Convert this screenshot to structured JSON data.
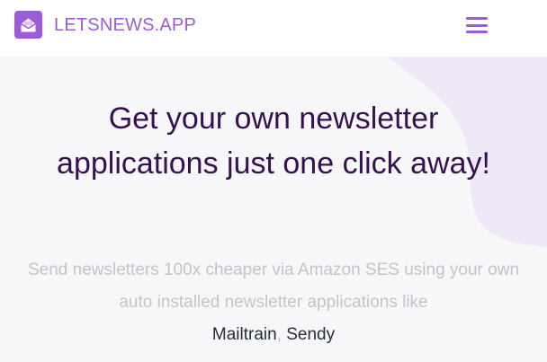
{
  "header": {
    "brand": "LETSNEWS.APP",
    "logo_icon": "envelope-open-icon",
    "menu_icon": "hamburger-menu-icon"
  },
  "hero": {
    "headline": "Get your own newsletter applications just one click away!",
    "subtext": "Send newsletters 100x cheaper via Amazon SES using your own auto installed newsletter applications like",
    "apps": [
      "Mailtrain",
      "Sendy"
    ],
    "separator": ","
  },
  "colors": {
    "brand": "#9b5cd6",
    "headline": "#34124f",
    "subtext": "#c4c4c9",
    "link": "#262c3a",
    "hero_bg": "#f7f7fa",
    "blob": "#efe8f7"
  }
}
